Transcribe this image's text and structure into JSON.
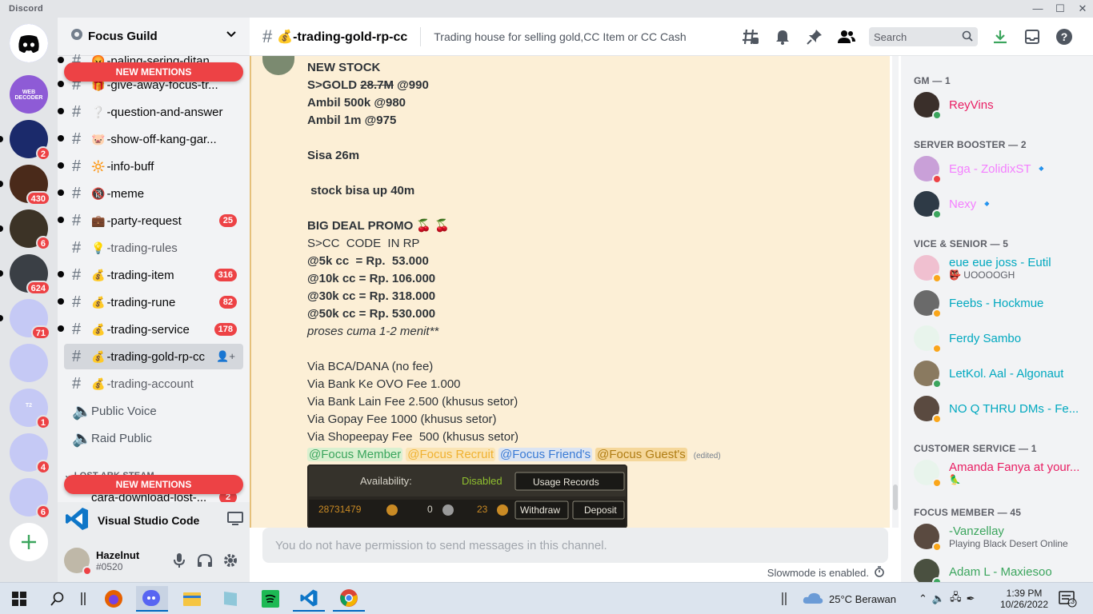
{
  "app": {
    "title": "Discord"
  },
  "guild": {
    "name": "Focus Guild"
  },
  "new_mentions": "NEW MENTIONS",
  "channels": [
    {
      "emoji": "😡",
      "name": "-paling-sering-ditan...",
      "muted": false,
      "count": ""
    },
    {
      "emoji": "🎁",
      "name": "-give-away-focus-tr...",
      "muted": false,
      "count": ""
    },
    {
      "emoji": "❔",
      "name": "-question-and-answer",
      "muted": false,
      "count": ""
    },
    {
      "emoji": "🐷",
      "name": "-show-off-kang-gar...",
      "muted": false,
      "count": ""
    },
    {
      "emoji": "🔆",
      "name": "-info-buff",
      "muted": false,
      "count": ""
    },
    {
      "emoji": "🔞",
      "name": "-meme",
      "muted": false,
      "count": ""
    },
    {
      "emoji": "💼",
      "name": "-party-request",
      "muted": false,
      "count": "25"
    },
    {
      "emoji": "💡",
      "name": "-trading-rules",
      "muted": true,
      "count": ""
    },
    {
      "emoji": "💰",
      "name": "-trading-item",
      "muted": false,
      "count": "316"
    },
    {
      "emoji": "💰",
      "name": "-trading-rune",
      "muted": false,
      "count": "82"
    },
    {
      "emoji": "💰",
      "name": "-trading-service",
      "muted": false,
      "count": "178"
    },
    {
      "emoji": "💰",
      "name": "-trading-gold-rp-cc",
      "muted": false,
      "count": ""
    },
    {
      "emoji": "💰",
      "name": "-trading-account",
      "muted": true,
      "count": ""
    }
  ],
  "voice_channels": [
    "Public Voice",
    "Raid Public"
  ],
  "category": "LOST ARK STEAM",
  "cut_channel": {
    "name": "cara-download-lost-...",
    "count": "2"
  },
  "activity": {
    "name": "Visual Studio Code"
  },
  "user": {
    "name": "Hazelnut",
    "tag": "#0520"
  },
  "servers": [
    {
      "badge": "",
      "color": "#5865f2",
      "label": "discord-home-icon"
    },
    {
      "badge": "",
      "color": "#8e5bd6",
      "label": "WEB DECODER"
    },
    {
      "badge": "2",
      "color": "#1b2a6b",
      "label": ""
    },
    {
      "badge": "430",
      "color": "#4a2a1a",
      "label": ""
    },
    {
      "badge": "6",
      "color": "#3c3326",
      "label": ""
    },
    {
      "badge": "624",
      "color": "#3a3f45",
      "label": ""
    },
    {
      "badge": "71",
      "color": "#c5c9f5",
      "label": ""
    },
    {
      "badge": "",
      "color": "#c5c9f5",
      "label": ""
    },
    {
      "badge": "1",
      "color": "#c5c9f5",
      "label": "T2"
    },
    {
      "badge": "4",
      "color": "#c5c9f5",
      "label": ""
    },
    {
      "badge": "6",
      "color": "#c5c9f5",
      "label": ""
    }
  ],
  "header": {
    "channel": "-trading-gold-rp-cc",
    "emoji": "💰",
    "topic": "Trading house for selling gold,CC Item or CC Cash",
    "search": "Search"
  },
  "message": {
    "lines": [
      {
        "text": "NEW STOCK",
        "style": "b"
      },
      {
        "parts": [
          {
            "t": "S>GOLD ",
            "s": "b"
          },
          {
            "t": "28.7M",
            "s": "b strike"
          },
          {
            "t": " @990",
            "s": "b"
          }
        ]
      },
      {
        "text": "Ambil 500k @980",
        "style": "b"
      },
      {
        "text": "Ambil 1m @975",
        "style": "b"
      },
      {
        "text": "",
        "style": ""
      },
      {
        "text": "Sisa 26m",
        "style": "b"
      },
      {
        "text": "",
        "style": ""
      },
      {
        "text": " stock bisa up 40m",
        "style": "b"
      },
      {
        "text": "",
        "style": ""
      },
      {
        "text": "BIG DEAL PROMO 🍒 🍒",
        "style": "b"
      },
      {
        "text": "S>CC  CODE  IN RP",
        "style": ""
      },
      {
        "text": "@5k cc  = Rp.  53.000",
        "style": "b"
      },
      {
        "text": "@10k cc = Rp. 106.000",
        "style": "b"
      },
      {
        "text": "@30k cc = Rp. 318.000",
        "style": "b"
      },
      {
        "text": "@50k cc = Rp. 530.000",
        "style": "b"
      },
      {
        "text": "proses cuma 1-2 menit**",
        "style": "i"
      },
      {
        "text": "",
        "style": ""
      },
      {
        "text": "Via BCA/DANA (no fee)",
        "style": ""
      },
      {
        "text": "Via Bank Ke OVO Fee 1.000",
        "style": ""
      },
      {
        "text": "Via Bank Lain Fee 2.500 (khusus setor)",
        "style": ""
      },
      {
        "text": "Via Gopay Fee 1000 (khusus setor)",
        "style": ""
      },
      {
        "text": "Via Shopeepay Fee  500 (khusus setor)",
        "style": ""
      }
    ],
    "mentions": [
      {
        "text": "@Focus Member",
        "color": "#3ba55d",
        "bg": "#d9f0d0"
      },
      {
        "text": "@Focus Recruit",
        "color": "#f0b232",
        "bg": "#fae4b4"
      },
      {
        "text": "@Focus Friend's",
        "color": "#3a7bd5",
        "bg": "#dbe4f2"
      },
      {
        "text": "@Focus Guest's",
        "color": "#b07d14",
        "bg": "#f5d79a"
      }
    ],
    "edited": "(edited)",
    "embed": {
      "availability_label": "Availability:",
      "availability_value": "Disabled",
      "usage_records": "Usage Records",
      "balance1": "28731479",
      "balance2": "0",
      "balance3": "23",
      "withdraw": "Withdraw",
      "deposit": "Deposit"
    }
  },
  "input": {
    "placeholder": "You do not have permission to send messages in this channel."
  },
  "slowmode": "Slowmode is enabled.",
  "members": {
    "groups": [
      {
        "title": "GM — 1",
        "items": [
          {
            "name": "ReyVins",
            "color": "#e91e63",
            "status": "#3ba55d",
            "sub": ""
          }
        ]
      },
      {
        "title": "SERVER BOOSTER — 2",
        "items": [
          {
            "name": "Ega - ZolidixST 🔹",
            "color": "#f47fff",
            "status": "#ed4245",
            "sub": ""
          },
          {
            "name": "Nexy 🔹",
            "color": "#f47fff",
            "status": "#3ba55d",
            "sub": ""
          }
        ]
      },
      {
        "title": "VICE & SENIOR — 5",
        "items": [
          {
            "name": "eue eue joss - Eutil",
            "color": "#00a8bf",
            "status": "#faa61a",
            "sub": "👺 UOOOOGH"
          },
          {
            "name": "Feebs - Hockmue",
            "color": "#00a8bf",
            "status": "#faa61a",
            "sub": ""
          },
          {
            "name": "Ferdy Sambo",
            "color": "#00a8bf",
            "status": "#faa61a",
            "sub": ""
          },
          {
            "name": "LetKol. Aal - Algonaut",
            "color": "#00a8bf",
            "status": "#3ba55d",
            "sub": ""
          },
          {
            "name": "NO Q THRU DMs - Fe...",
            "color": "#00a8bf",
            "status": "#faa61a",
            "sub": ""
          }
        ]
      },
      {
        "title": "CUSTOMER SERVICE — 1",
        "items": [
          {
            "name": "Amanda Fanya at your...",
            "color": "#e91e63",
            "status": "#faa61a",
            "sub": "🦜"
          }
        ]
      },
      {
        "title": "FOCUS MEMBER — 45",
        "items": [
          {
            "name": "-Vanzellay",
            "color": "#3ba55d",
            "status": "#faa61a",
            "sub": "Playing Black Desert Online"
          },
          {
            "name": "Adam L - Maxiesoo",
            "color": "#3ba55d",
            "status": "#3ba55d",
            "sub": ""
          }
        ]
      }
    ]
  },
  "taskbar": {
    "weather": "25°C  Berawan",
    "time": "1:39 PM",
    "date": "10/26/2022",
    "notif": "13"
  },
  "colors": {
    "accent": "#5865f2",
    "mention_bg": "#fcefd6",
    "badge": "#ed4245"
  }
}
